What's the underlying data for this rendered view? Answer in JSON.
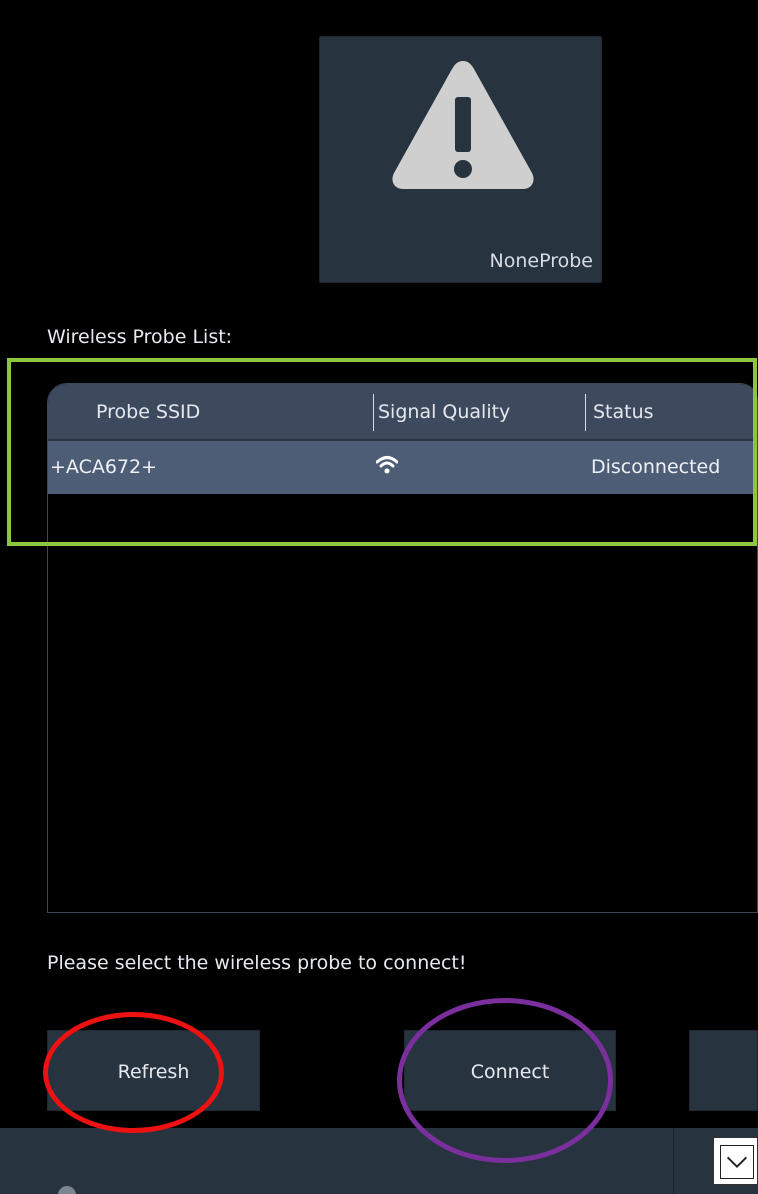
{
  "probe": {
    "name": "NoneProbe",
    "icon": "warning-triangle-icon"
  },
  "list": {
    "title": "Wireless Probe List:",
    "columns": [
      "Probe SSID",
      "Signal Quality",
      "Status"
    ],
    "rows": [
      {
        "ssid": "+ACA672+",
        "signal_icon": "wifi-icon",
        "status": "Disconnected"
      }
    ]
  },
  "hint": "Please select the wireless probe to connect!",
  "buttons": {
    "refresh": "Refresh",
    "connect": "Connect"
  },
  "colors": {
    "background": "#000000",
    "panel": "#283340",
    "header": "#3d4a5e",
    "selected_row": "#4e5d76",
    "highlight_green": "#8cc63f",
    "ring_red": "#ee1111",
    "ring_purple": "#7a2f9c"
  }
}
